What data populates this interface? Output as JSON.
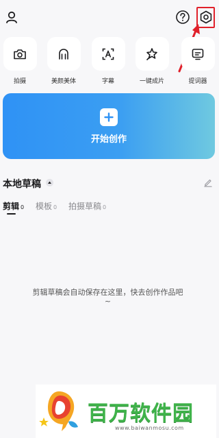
{
  "tools": [
    {
      "label": "拍摄",
      "icon": "camera-icon"
    },
    {
      "label": "美颜美体",
      "icon": "beauty-icon"
    },
    {
      "label": "字幕",
      "icon": "subtitle-icon"
    },
    {
      "label": "一键成片",
      "icon": "one-click-film-icon"
    },
    {
      "label": "提词器",
      "icon": "teleprompter-icon"
    }
  ],
  "create": {
    "label": "开始创作"
  },
  "drafts": {
    "title": "本地草稿",
    "tabs": [
      {
        "label": "剪辑",
        "count": "0",
        "active": true
      },
      {
        "label": "模板",
        "count": "0",
        "active": false
      },
      {
        "label": "拍摄草稿",
        "count": "0",
        "active": false
      }
    ],
    "empty_message": "剪辑草稿会自动保存在这里，快去创作作品吧",
    "empty_tilde": "~"
  },
  "watermark": {
    "brand": "百万软件园",
    "url": "www.baiwanmosu.com"
  },
  "colors": {
    "accent_blue": "#2f92f5",
    "annotation_red": "#e0202a",
    "watermark_green": "#3fb34a"
  }
}
